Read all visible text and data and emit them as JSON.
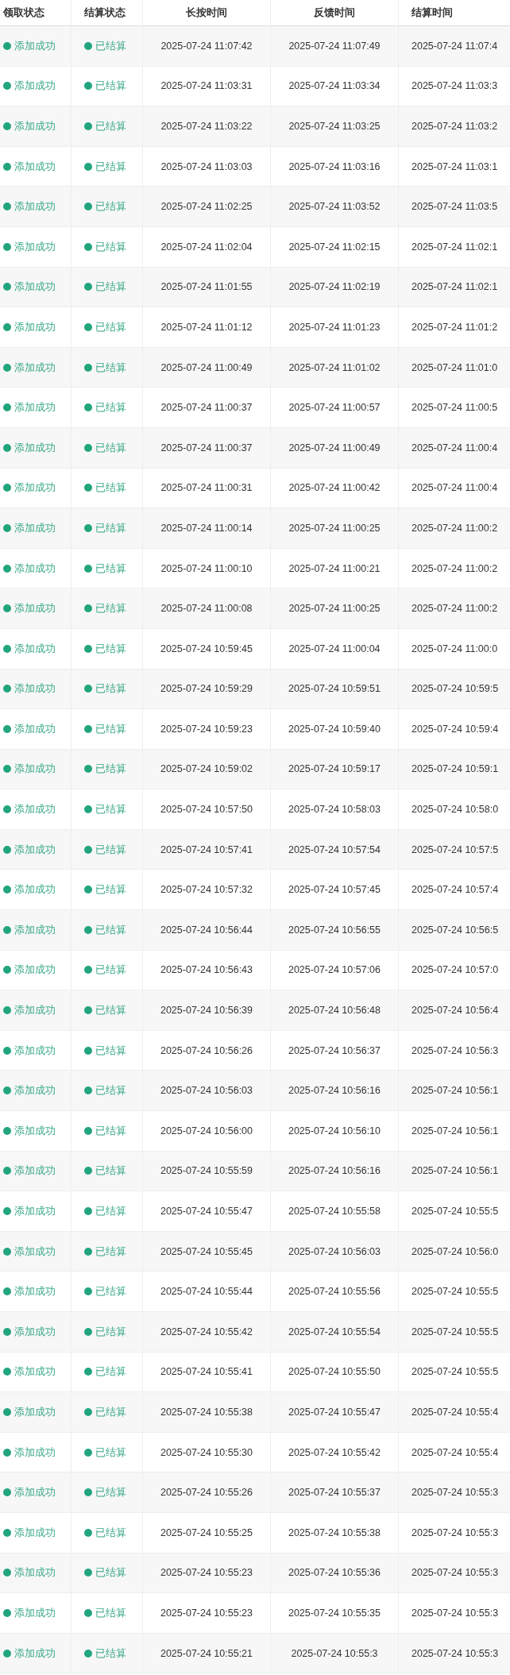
{
  "table": {
    "columns": [
      "领取状态",
      "结算状态",
      "长按时间",
      "反馈时间",
      "结算时间"
    ],
    "rows": [
      {
        "claim_status": "添加成功",
        "settle_status": "已结算",
        "press_time": "2025-07-24 11:07:42",
        "feedback_time": "2025-07-24 11:07:49",
        "settle_time": "2025-07-24 11:07:4"
      },
      {
        "claim_status": "添加成功",
        "settle_status": "已结算",
        "press_time": "2025-07-24 11:03:31",
        "feedback_time": "2025-07-24 11:03:34",
        "settle_time": "2025-07-24 11:03:3"
      },
      {
        "claim_status": "添加成功",
        "settle_status": "已结算",
        "press_time": "2025-07-24 11:03:22",
        "feedback_time": "2025-07-24 11:03:25",
        "settle_time": "2025-07-24 11:03:2"
      },
      {
        "claim_status": "添加成功",
        "settle_status": "已结算",
        "press_time": "2025-07-24 11:03:03",
        "feedback_time": "2025-07-24 11:03:16",
        "settle_time": "2025-07-24 11:03:1"
      },
      {
        "claim_status": "添加成功",
        "settle_status": "已结算",
        "press_time": "2025-07-24 11:02:25",
        "feedback_time": "2025-07-24 11:03:52",
        "settle_time": "2025-07-24 11:03:5"
      },
      {
        "claim_status": "添加成功",
        "settle_status": "已结算",
        "press_time": "2025-07-24 11:02:04",
        "feedback_time": "2025-07-24 11:02:15",
        "settle_time": "2025-07-24 11:02:1"
      },
      {
        "claim_status": "添加成功",
        "settle_status": "已结算",
        "press_time": "2025-07-24 11:01:55",
        "feedback_time": "2025-07-24 11:02:19",
        "settle_time": "2025-07-24 11:02:1"
      },
      {
        "claim_status": "添加成功",
        "settle_status": "已结算",
        "press_time": "2025-07-24 11:01:12",
        "feedback_time": "2025-07-24 11:01:23",
        "settle_time": "2025-07-24 11:01:2"
      },
      {
        "claim_status": "添加成功",
        "settle_status": "已结算",
        "press_time": "2025-07-24 11:00:49",
        "feedback_time": "2025-07-24 11:01:02",
        "settle_time": "2025-07-24 11:01:0"
      },
      {
        "claim_status": "添加成功",
        "settle_status": "已结算",
        "press_time": "2025-07-24 11:00:37",
        "feedback_time": "2025-07-24 11:00:57",
        "settle_time": "2025-07-24 11:00:5"
      },
      {
        "claim_status": "添加成功",
        "settle_status": "已结算",
        "press_time": "2025-07-24 11:00:37",
        "feedback_time": "2025-07-24 11:00:49",
        "settle_time": "2025-07-24 11:00:4"
      },
      {
        "claim_status": "添加成功",
        "settle_status": "已结算",
        "press_time": "2025-07-24 11:00:31",
        "feedback_time": "2025-07-24 11:00:42",
        "settle_time": "2025-07-24 11:00:4"
      },
      {
        "claim_status": "添加成功",
        "settle_status": "已结算",
        "press_time": "2025-07-24 11:00:14",
        "feedback_time": "2025-07-24 11:00:25",
        "settle_time": "2025-07-24 11:00:2"
      },
      {
        "claim_status": "添加成功",
        "settle_status": "已结算",
        "press_time": "2025-07-24 11:00:10",
        "feedback_time": "2025-07-24 11:00:21",
        "settle_time": "2025-07-24 11:00:2"
      },
      {
        "claim_status": "添加成功",
        "settle_status": "已结算",
        "press_time": "2025-07-24 11:00:08",
        "feedback_time": "2025-07-24 11:00:25",
        "settle_time": "2025-07-24 11:00:2"
      },
      {
        "claim_status": "添加成功",
        "settle_status": "已结算",
        "press_time": "2025-07-24 10:59:45",
        "feedback_time": "2025-07-24 11:00:04",
        "settle_time": "2025-07-24 11:00:0"
      },
      {
        "claim_status": "添加成功",
        "settle_status": "已结算",
        "press_time": "2025-07-24 10:59:29",
        "feedback_time": "2025-07-24 10:59:51",
        "settle_time": "2025-07-24 10:59:5"
      },
      {
        "claim_status": "添加成功",
        "settle_status": "已结算",
        "press_time": "2025-07-24 10:59:23",
        "feedback_time": "2025-07-24 10:59:40",
        "settle_time": "2025-07-24 10:59:4"
      },
      {
        "claim_status": "添加成功",
        "settle_status": "已结算",
        "press_time": "2025-07-24 10:59:02",
        "feedback_time": "2025-07-24 10:59:17",
        "settle_time": "2025-07-24 10:59:1"
      },
      {
        "claim_status": "添加成功",
        "settle_status": "已结算",
        "press_time": "2025-07-24 10:57:50",
        "feedback_time": "2025-07-24 10:58:03",
        "settle_time": "2025-07-24 10:58:0"
      },
      {
        "claim_status": "添加成功",
        "settle_status": "已结算",
        "press_time": "2025-07-24 10:57:41",
        "feedback_time": "2025-07-24 10:57:54",
        "settle_time": "2025-07-24 10:57:5"
      },
      {
        "claim_status": "添加成功",
        "settle_status": "已结算",
        "press_time": "2025-07-24 10:57:32",
        "feedback_time": "2025-07-24 10:57:45",
        "settle_time": "2025-07-24 10:57:4"
      },
      {
        "claim_status": "添加成功",
        "settle_status": "已结算",
        "press_time": "2025-07-24 10:56:44",
        "feedback_time": "2025-07-24 10:56:55",
        "settle_time": "2025-07-24 10:56:5"
      },
      {
        "claim_status": "添加成功",
        "settle_status": "已结算",
        "press_time": "2025-07-24 10:56:43",
        "feedback_time": "2025-07-24 10:57:06",
        "settle_time": "2025-07-24 10:57:0"
      },
      {
        "claim_status": "添加成功",
        "settle_status": "已结算",
        "press_time": "2025-07-24 10:56:39",
        "feedback_time": "2025-07-24 10:56:48",
        "settle_time": "2025-07-24 10:56:4"
      },
      {
        "claim_status": "添加成功",
        "settle_status": "已结算",
        "press_time": "2025-07-24 10:56:26",
        "feedback_time": "2025-07-24 10:56:37",
        "settle_time": "2025-07-24 10:56:3"
      },
      {
        "claim_status": "添加成功",
        "settle_status": "已结算",
        "press_time": "2025-07-24 10:56:03",
        "feedback_time": "2025-07-24 10:56:16",
        "settle_time": "2025-07-24 10:56:1"
      },
      {
        "claim_status": "添加成功",
        "settle_status": "已结算",
        "press_time": "2025-07-24 10:56:00",
        "feedback_time": "2025-07-24 10:56:10",
        "settle_time": "2025-07-24 10:56:1"
      },
      {
        "claim_status": "添加成功",
        "settle_status": "已结算",
        "press_time": "2025-07-24 10:55:59",
        "feedback_time": "2025-07-24 10:56:16",
        "settle_time": "2025-07-24 10:56:1"
      },
      {
        "claim_status": "添加成功",
        "settle_status": "已结算",
        "press_time": "2025-07-24 10:55:47",
        "feedback_time": "2025-07-24 10:55:58",
        "settle_time": "2025-07-24 10:55:5"
      },
      {
        "claim_status": "添加成功",
        "settle_status": "已结算",
        "press_time": "2025-07-24 10:55:45",
        "feedback_time": "2025-07-24 10:56:03",
        "settle_time": "2025-07-24 10:56:0"
      },
      {
        "claim_status": "添加成功",
        "settle_status": "已结算",
        "press_time": "2025-07-24 10:55:44",
        "feedback_time": "2025-07-24 10:55:56",
        "settle_time": "2025-07-24 10:55:5"
      },
      {
        "claim_status": "添加成功",
        "settle_status": "已结算",
        "press_time": "2025-07-24 10:55:42",
        "feedback_time": "2025-07-24 10:55:54",
        "settle_time": "2025-07-24 10:55:5"
      },
      {
        "claim_status": "添加成功",
        "settle_status": "已结算",
        "press_time": "2025-07-24 10:55:41",
        "feedback_time": "2025-07-24 10:55:50",
        "settle_time": "2025-07-24 10:55:5"
      },
      {
        "claim_status": "添加成功",
        "settle_status": "已结算",
        "press_time": "2025-07-24 10:55:38",
        "feedback_time": "2025-07-24 10:55:47",
        "settle_time": "2025-07-24 10:55:4"
      },
      {
        "claim_status": "添加成功",
        "settle_status": "已结算",
        "press_time": "2025-07-24 10:55:30",
        "feedback_time": "2025-07-24 10:55:42",
        "settle_time": "2025-07-24 10:55:4"
      },
      {
        "claim_status": "添加成功",
        "settle_status": "已结算",
        "press_time": "2025-07-24 10:55:26",
        "feedback_time": "2025-07-24 10:55:37",
        "settle_time": "2025-07-24 10:55:3"
      },
      {
        "claim_status": "添加成功",
        "settle_status": "已结算",
        "press_time": "2025-07-24 10:55:25",
        "feedback_time": "2025-07-24 10:55:38",
        "settle_time": "2025-07-24 10:55:3"
      },
      {
        "claim_status": "添加成功",
        "settle_status": "已结算",
        "press_time": "2025-07-24 10:55:23",
        "feedback_time": "2025-07-24 10:55:36",
        "settle_time": "2025-07-24 10:55:3"
      },
      {
        "claim_status": "添加成功",
        "settle_status": "已结算",
        "press_time": "2025-07-24 10:55:23",
        "feedback_time": "2025-07-24 10:55:35",
        "settle_time": "2025-07-24 10:55:3"
      },
      {
        "claim_status": "添加成功",
        "settle_status": "已结算",
        "press_time": "2025-07-24 10:55:21",
        "feedback_time": "2025-07-24 10:55:3",
        "settle_time": "2025-07-24 10:55:3"
      }
    ]
  }
}
